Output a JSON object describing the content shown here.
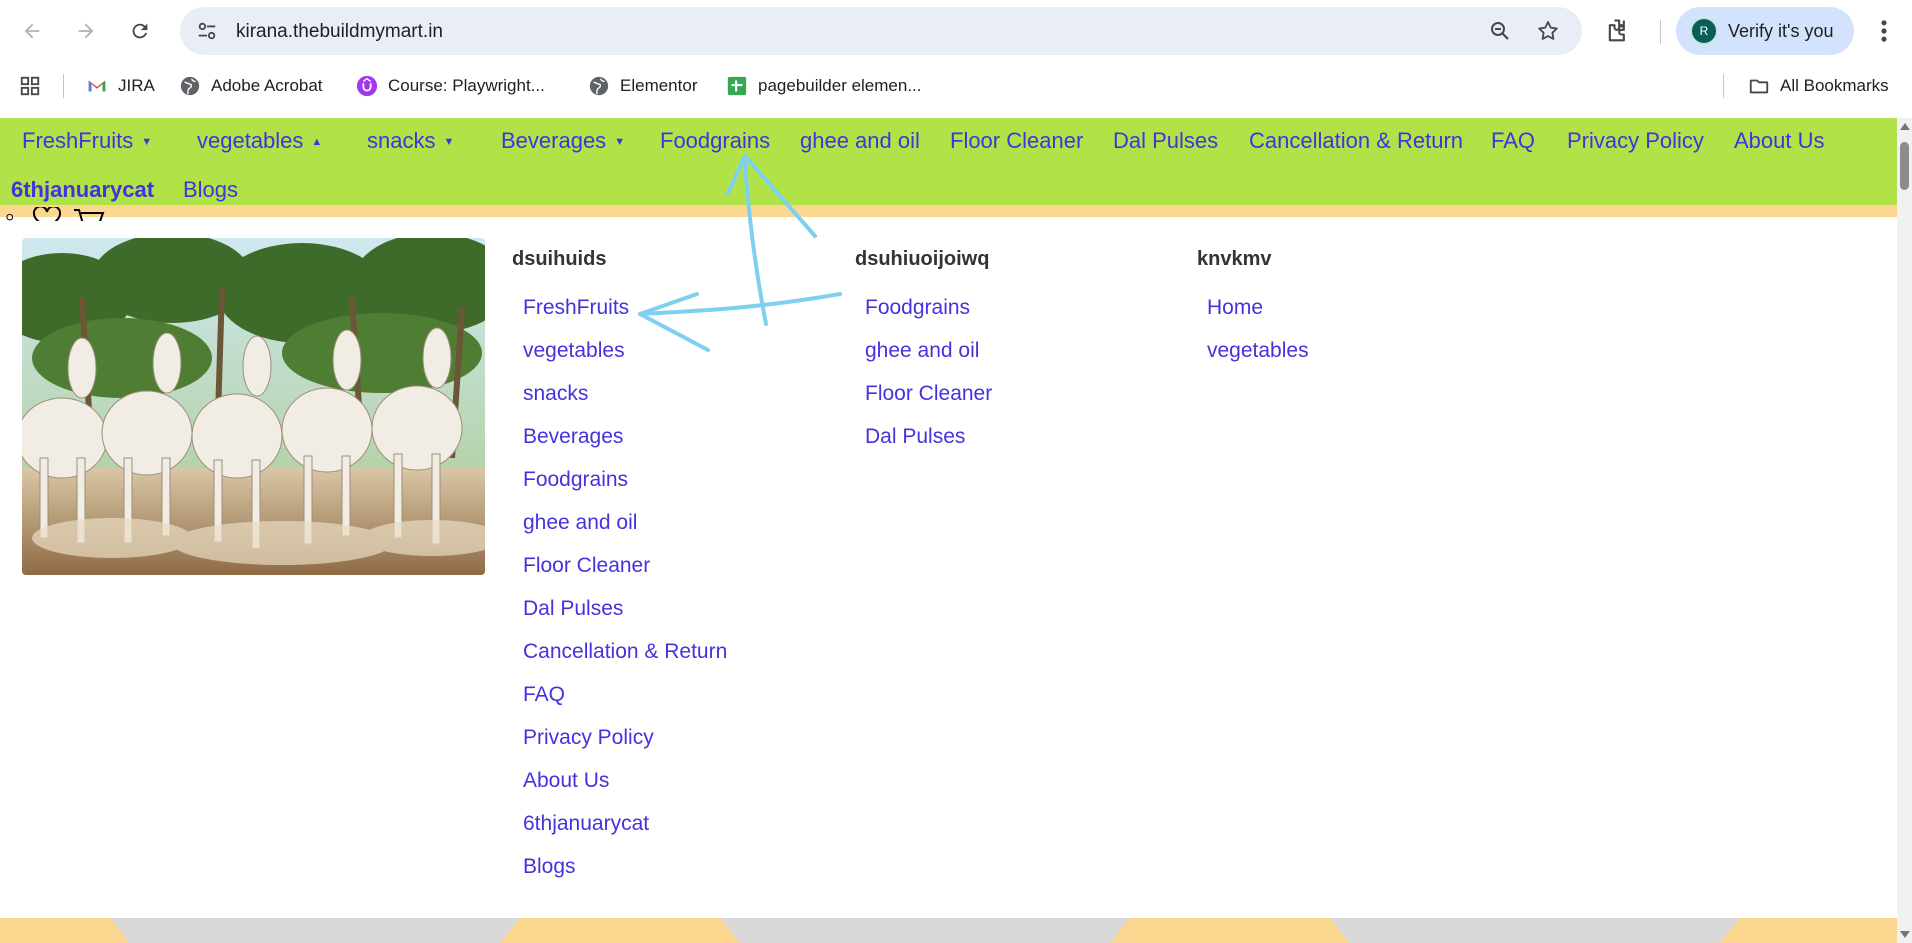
{
  "browser": {
    "url": "kirana.thebuildmymart.in",
    "profile_initial": "R",
    "verify_label": "Verify it's you",
    "bookmarks": [
      {
        "label": "JIRA",
        "icon": "gmail-icon"
      },
      {
        "label": "Adobe Acrobat",
        "icon": "globe-icon"
      },
      {
        "label": "Course: Playwright...",
        "icon": "udemy-icon"
      },
      {
        "label": "Elementor",
        "icon": "globe-icon"
      },
      {
        "label": "pagebuilder elemen...",
        "icon": "sheets-icon"
      }
    ],
    "all_bookmarks_label": "All Bookmarks"
  },
  "navbar": {
    "items": [
      {
        "label": "FreshFruits",
        "caret": "▼"
      },
      {
        "label": "vegetables",
        "caret": "▲"
      },
      {
        "label": "snacks",
        "caret": "▼"
      },
      {
        "label": "Beverages",
        "caret": "▼"
      },
      {
        "label": "Foodgrains"
      },
      {
        "label": "ghee and oil"
      },
      {
        "label": "Floor Cleaner"
      },
      {
        "label": "Dal Pulses"
      },
      {
        "label": "Cancellation & Return"
      },
      {
        "label": "FAQ"
      },
      {
        "label": "Privacy Policy"
      },
      {
        "label": "About Us"
      },
      {
        "label": "6thjanuarycat"
      },
      {
        "label": "Blogs"
      }
    ]
  },
  "mega_menu": {
    "columns": [
      {
        "heading": "dsuihuids",
        "links": [
          "FreshFruits",
          "vegetables",
          "snacks",
          "Beverages",
          "Foodgrains",
          "ghee and oil",
          "Floor Cleaner",
          "Dal Pulses",
          "Cancellation & Return",
          "FAQ",
          "Privacy Policy",
          "About Us",
          "6thjanuarycat",
          "Blogs"
        ]
      },
      {
        "heading": "dsuhiuoijoiwq",
        "links": [
          "Foodgrains",
          "ghee and oil",
          "Floor Cleaner",
          "Dal Pulses"
        ]
      },
      {
        "heading": "knvkmv",
        "links": [
          "Home",
          "vegetables"
        ]
      }
    ]
  },
  "colors": {
    "navbar_bg": "#b1e348",
    "link": "#4433dd",
    "accent_strip": "#fbd78f",
    "annotation": "#7fcff0"
  }
}
